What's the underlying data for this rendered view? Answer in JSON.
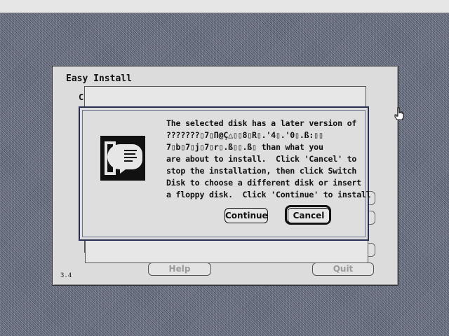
{
  "window": {
    "title": "Easy Install",
    "inner_label": "C",
    "version": "3.4",
    "help_label": "Help",
    "quit_label": "Quit"
  },
  "alert": {
    "message": "The selected disk has a later version of\n???????▯7▯Π@Ç△▯▯8▯R▯.'4▯.'0▯.ß:▯▯\n7▯b▯7▯j▯7▯r▯.ß▯▯.ß▯ than what you\nare about to install.  Click 'Cancel' to\nstop the installation, then click Switch\nDisk to choose a different disk or insert\na floppy disk.  Click 'Continue' to install",
    "continue_label": "Continue",
    "cancel_label": "Cancel",
    "icon": "note-alert-icon"
  },
  "cursor": {
    "icon": "hand-pointer-icon"
  }
}
